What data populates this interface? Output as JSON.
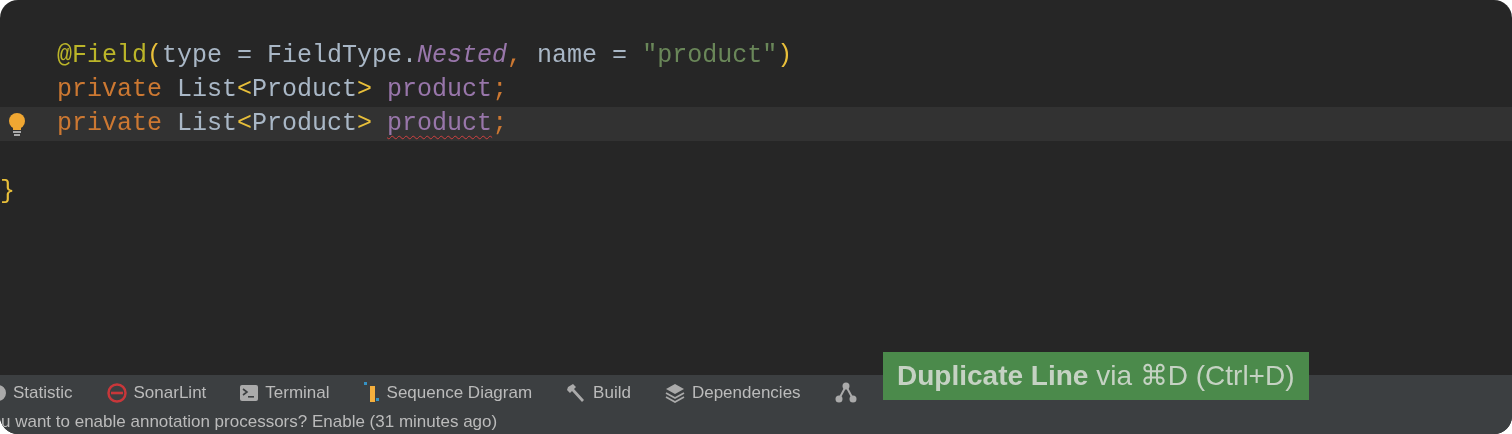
{
  "editor": {
    "lines": [
      {
        "kind": "blank"
      },
      {
        "kind": "code",
        "current": false,
        "bulb": false,
        "tokens": [
          {
            "kind": "annotation",
            "text": "@Field"
          },
          {
            "kind": "brace",
            "text": "("
          },
          {
            "kind": "plain",
            "text": "type = FieldType."
          },
          {
            "kind": "constant",
            "text": "Nested"
          },
          {
            "kind": "keyword",
            "text": ", "
          },
          {
            "kind": "plain",
            "text": "name = "
          },
          {
            "kind": "string",
            "text": "\"product\""
          },
          {
            "kind": "brace",
            "text": ")"
          }
        ]
      },
      {
        "kind": "code",
        "current": false,
        "bulb": false,
        "tokens": [
          {
            "kind": "keyword",
            "text": "private "
          },
          {
            "kind": "plain",
            "text": "List"
          },
          {
            "kind": "brace",
            "text": "<"
          },
          {
            "kind": "plain",
            "text": "Product"
          },
          {
            "kind": "brace",
            "text": "> "
          },
          {
            "kind": "field",
            "text": "product",
            "squiggle": false
          },
          {
            "kind": "keyword",
            "text": ";"
          }
        ]
      },
      {
        "kind": "code",
        "current": true,
        "bulb": true,
        "tokens": [
          {
            "kind": "keyword",
            "text": "private "
          },
          {
            "kind": "plain",
            "text": "List"
          },
          {
            "kind": "brace",
            "text": "<"
          },
          {
            "kind": "plain",
            "text": "Product"
          },
          {
            "kind": "brace",
            "text": "> "
          },
          {
            "kind": "field",
            "text": "product",
            "squiggle": true
          },
          {
            "kind": "keyword",
            "text": ";"
          }
        ]
      },
      {
        "kind": "blank"
      },
      {
        "kind": "code",
        "current": false,
        "bulb": false,
        "tokens": [
          {
            "kind": "closing",
            "text": "}"
          }
        ]
      }
    ]
  },
  "tool_windows": [
    {
      "kind": "statistic",
      "label": "Statistic"
    },
    {
      "kind": "sonarlint",
      "label": "SonarLint"
    },
    {
      "kind": "terminal",
      "label": "Terminal"
    },
    {
      "kind": "sequence",
      "label": "Sequence Diagram"
    },
    {
      "kind": "build",
      "label": "Build"
    },
    {
      "kind": "dependencies",
      "label": "Dependencies"
    },
    {
      "kind": "graph"
    }
  ],
  "status_bar": {
    "message": "u want to enable annotation processors? Enable (31 minutes ago)"
  },
  "tooltip": {
    "text": "**Duplicate Line** via ⌘D (Ctrl+D)"
  }
}
